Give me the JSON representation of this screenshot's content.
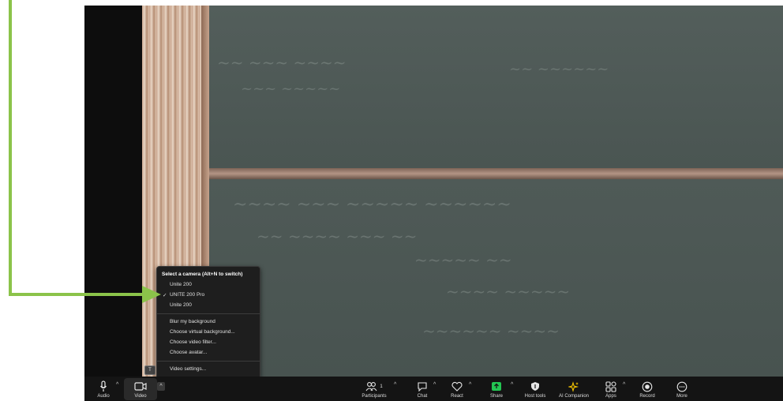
{
  "camera_menu": {
    "header": "Select a camera (Alt+N to switch)",
    "cameras": [
      {
        "label": "Unite 200",
        "selected": false
      },
      {
        "label": "UNITE 200 Pro",
        "selected": true
      },
      {
        "label": "Unite 200",
        "selected": false
      }
    ],
    "check_mark": "✓",
    "options": [
      "Blur my background",
      "Choose virtual background...",
      "Choose video filter...",
      "Choose avatar..."
    ],
    "settings": "Video settings..."
  },
  "toolbar": {
    "audio_label": "Audio",
    "video_label": "Video",
    "participants_label": "Participants",
    "participants_count": "1",
    "chat_label": "Chat",
    "react_label": "React",
    "share_label": "Share",
    "host_tools_label": "Host tools",
    "ai_companion_label": "AI Companion",
    "apps_label": "Apps",
    "record_label": "Record",
    "more_label": "More"
  },
  "colors": {
    "arrow": "#8bc34a",
    "share_icon": "#23c552",
    "ai_icon": "#f5c400",
    "toolbar_bg": "#141414"
  }
}
